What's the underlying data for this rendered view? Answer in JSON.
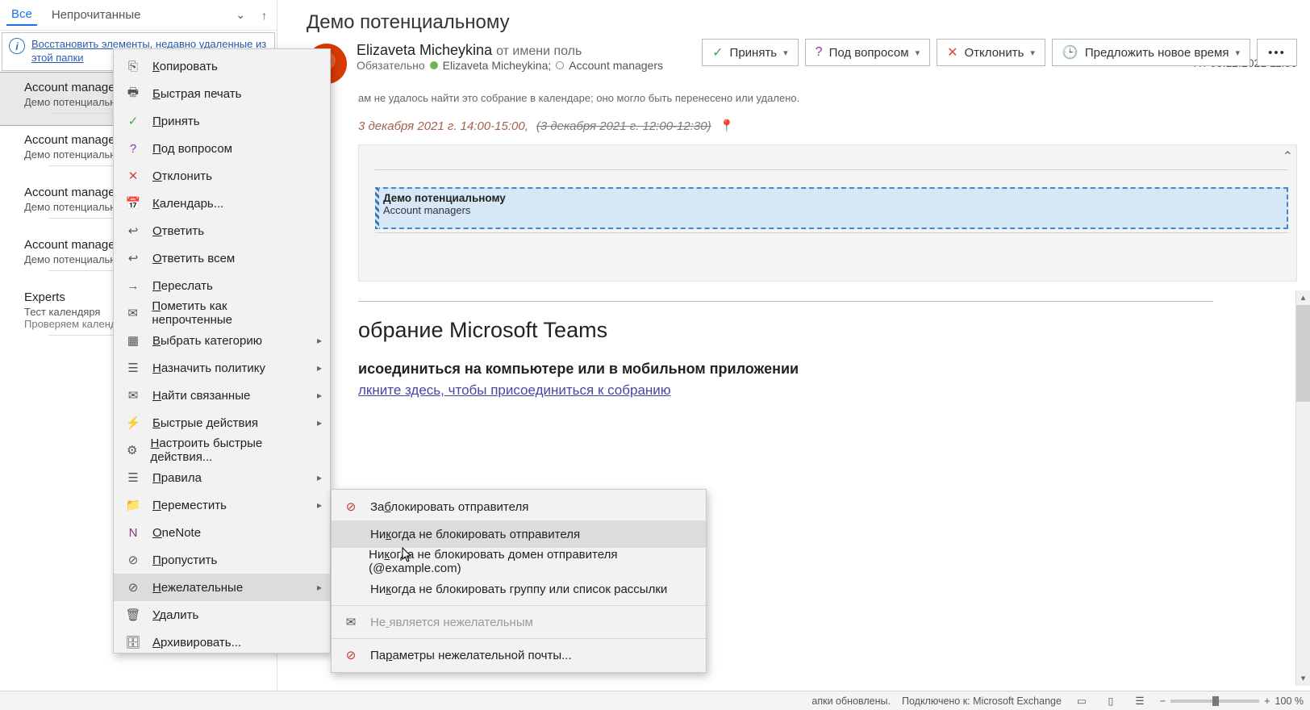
{
  "mail_list": {
    "tabs": {
      "all": "Все",
      "unread": "Непрочитанные"
    },
    "restore_link": "Восстановить элементы, недавно удаленные из этой папки",
    "items": [
      {
        "sender": "Account managers",
        "subject": "Демо потенциальному"
      },
      {
        "sender": "Account managers",
        "subject": "Демо потенциальному"
      },
      {
        "sender": "Account managers",
        "subject": "Демо потенциальному"
      },
      {
        "sender": "Account managers",
        "subject": "Демо потенциальному"
      },
      {
        "sender": "Experts",
        "subject": "Тест календяря",
        "preview": "Проверяем календ"
      }
    ]
  },
  "reading": {
    "title": "Демо потенциальному",
    "from_name": "Elizaveta Micheykina",
    "from_tail": "от имени поль",
    "required_label": "Обязательно",
    "recip1": "Elizaveta Micheykina;",
    "recip2": "Account managers",
    "date": "Пт 03.12.2021 11:30",
    "warning": "ам не удалось найти это собрание в календаре; оно могло быть перенесено или удалено.",
    "when_current": "3 декабря 2021 г. 14:00-15:00,",
    "when_old": "(3 декабря 2021 г. 12:00-12:30)",
    "slot_title": "Демо потенциальному",
    "slot_org": "Account managers",
    "teams_heading": "обрание Microsoft Teams",
    "join_heading": "исоединиться на компьютере или в мобильном приложении",
    "join_link": "лкните здесь, чтобы присоединиться к собранию"
  },
  "actions": {
    "accept": "Принять",
    "tentative": "Под вопросом",
    "decline": "Отклонить",
    "propose": "Предложить новое время"
  },
  "context_menu": {
    "items": [
      {
        "label": "Копировать",
        "icon": "⎘"
      },
      {
        "label": "Быстрая печать",
        "icon": "🖶"
      },
      {
        "label": "Принять",
        "icon": "✓",
        "color": "#4aa04a"
      },
      {
        "label": "Под вопросом",
        "icon": "?",
        "color": "#9030b5"
      },
      {
        "label": "Отклонить",
        "icon": "✕",
        "color": "#d04848"
      },
      {
        "label": "Календарь...",
        "icon": "📅"
      },
      {
        "label": "Ответить",
        "icon": "↩"
      },
      {
        "label": "Ответить всем",
        "icon": "↩"
      },
      {
        "label": "Переслать",
        "icon": "→"
      },
      {
        "label": "Пометить как непрочтенные",
        "icon": "✉"
      },
      {
        "label": "Выбрать категорию",
        "icon": "▦",
        "sub": true
      },
      {
        "label": "Назначить политику",
        "icon": "☰",
        "sub": true
      },
      {
        "label": "Найти связанные",
        "icon": "✉",
        "sub": true
      },
      {
        "label": "Быстрые действия",
        "icon": "⚡",
        "sub": true
      },
      {
        "label": "Настроить быстрые действия...",
        "icon": "⚙"
      },
      {
        "label": "Правила",
        "icon": "☰",
        "sub": true
      },
      {
        "label": "Переместить",
        "icon": "📁",
        "sub": true
      },
      {
        "label": "OneNote",
        "icon": "N",
        "color": "#80397b"
      },
      {
        "label": "Пропустить",
        "icon": "⊘"
      },
      {
        "label": "Нежелательные",
        "icon": "⊘",
        "sub": true,
        "hl": true
      },
      {
        "label": "Удалить",
        "icon": "🗑"
      },
      {
        "label": "Архивировать...",
        "icon": "🗄"
      }
    ]
  },
  "sub_menu": {
    "items": [
      {
        "label": "Заблокировать отправителя",
        "icon": true
      },
      {
        "label": "Никогда не блокировать отправителя",
        "hl": true
      },
      {
        "label": "Никогда не блокировать домен отправителя (@example.com)"
      },
      {
        "label": "Никогда не блокировать группу или список рассылки"
      },
      {
        "label": "Не является нежелательным",
        "disabled": true,
        "mail_icon": true
      },
      {
        "label": "Параметры нежелательной почты...",
        "icon": true
      }
    ]
  },
  "statusbar": {
    "updated": "апки обновлены.",
    "connected": "Подключено к: Microsoft Exchange",
    "zoom": "100 %"
  }
}
